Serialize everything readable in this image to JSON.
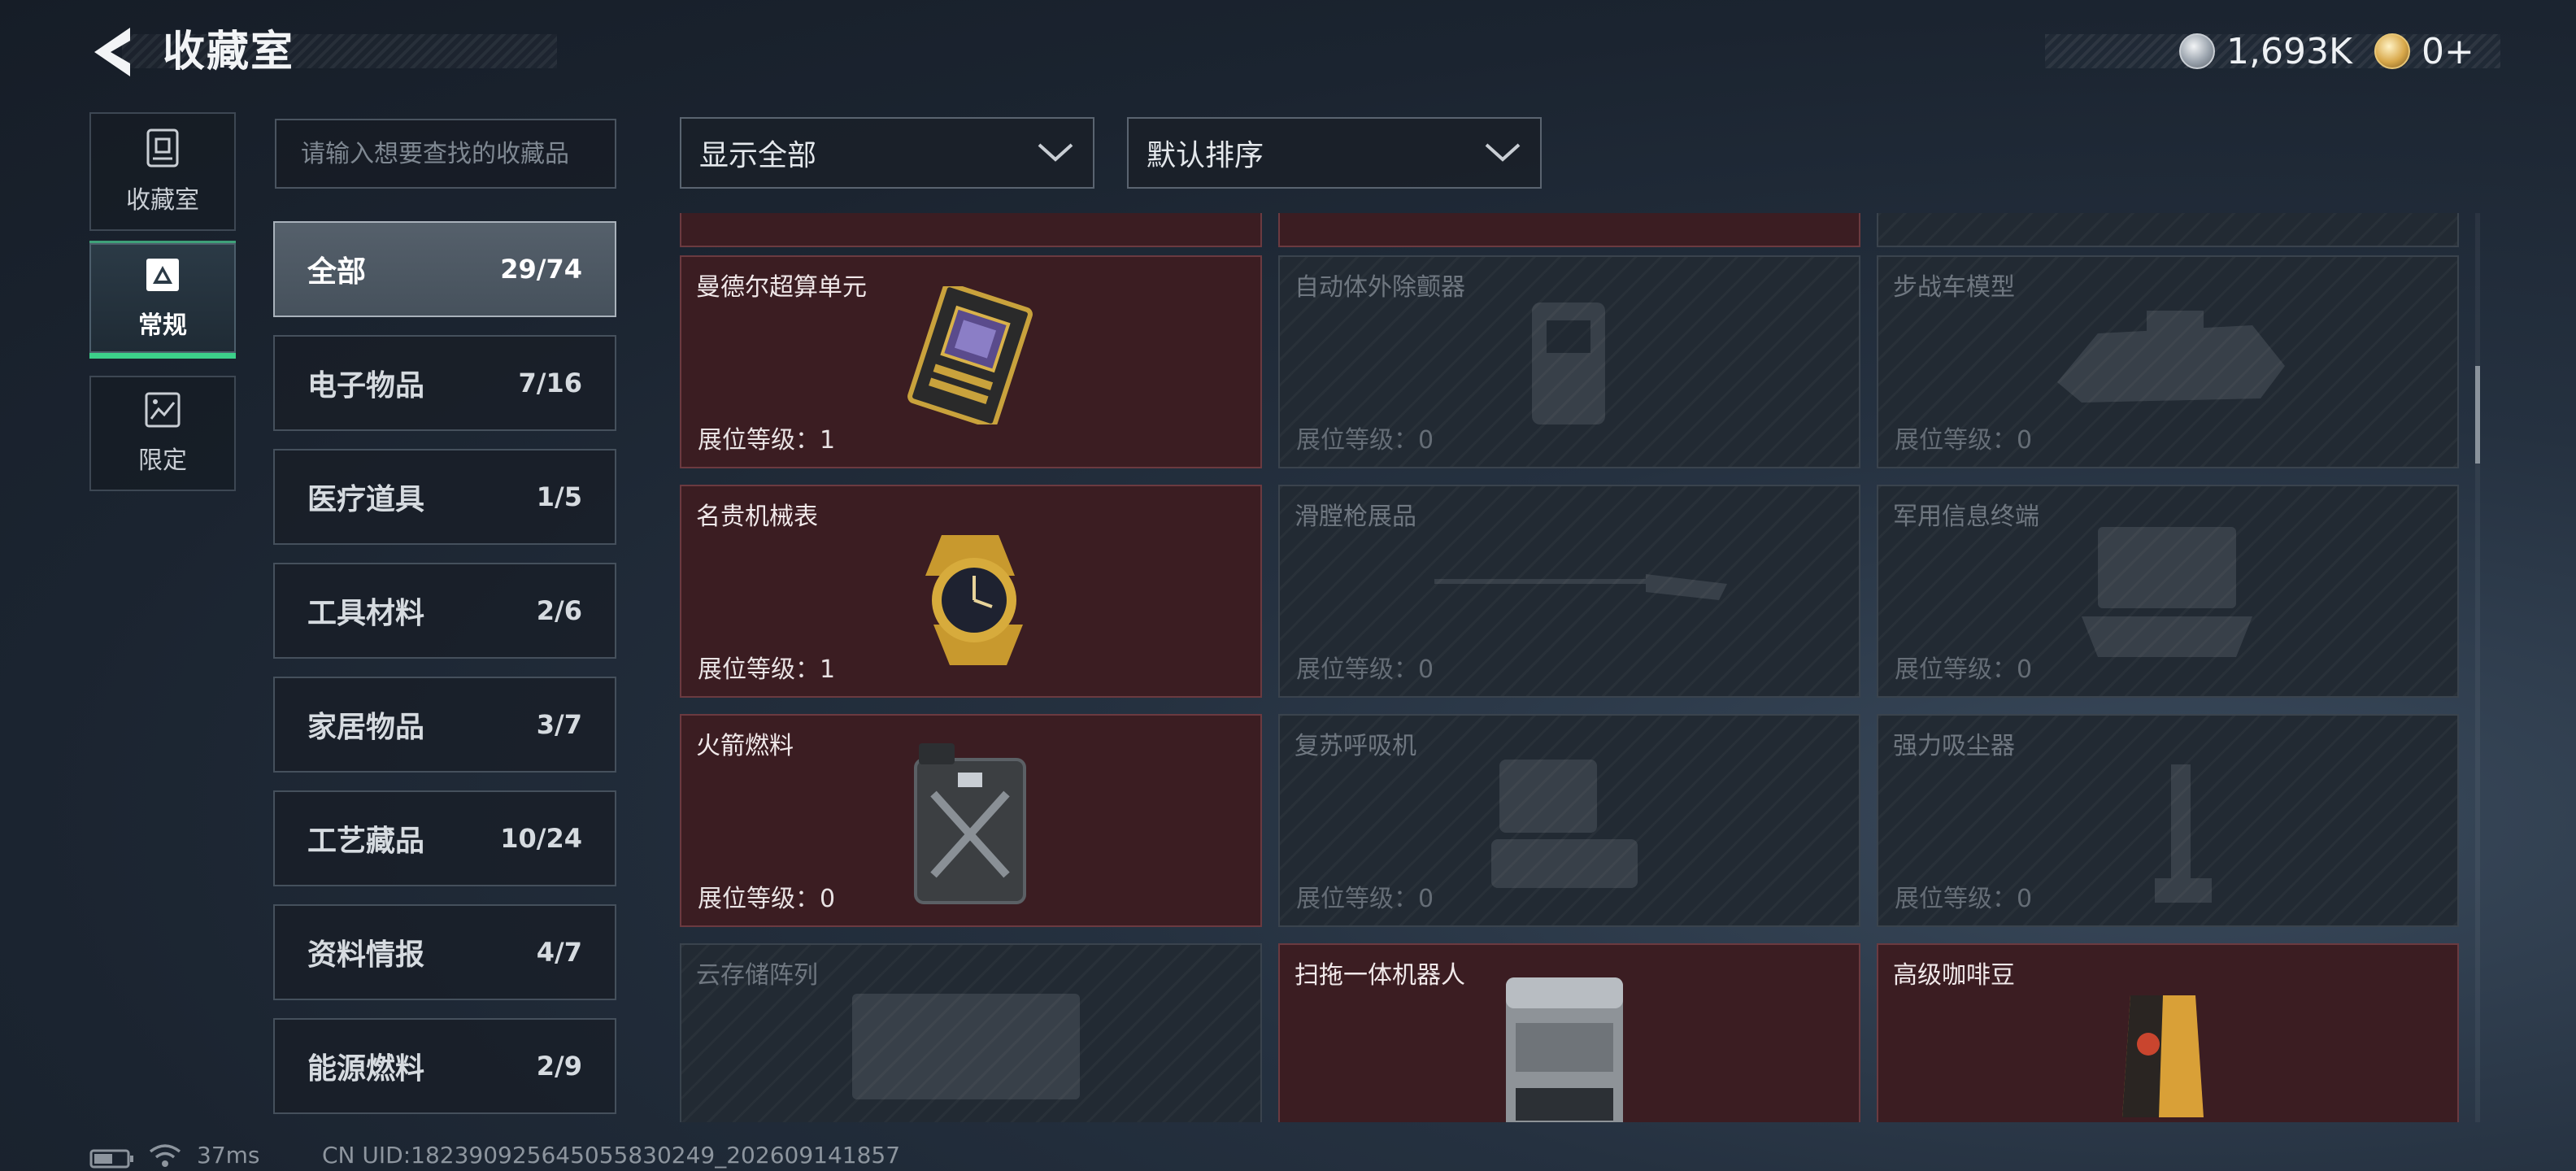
{
  "header": {
    "title": "收藏室",
    "currencies": [
      {
        "icon": "silver-coin-icon",
        "value": "1,693K"
      },
      {
        "icon": "gold-coin-icon",
        "value": "0+"
      }
    ]
  },
  "rail": [
    {
      "label": "收藏室",
      "icon": "collection-room-icon",
      "active": false
    },
    {
      "label": "常规",
      "icon": "regular-icon",
      "active": true
    },
    {
      "label": "限定",
      "icon": "limited-icon",
      "active": false
    }
  ],
  "search": {
    "placeholder": "请输入想要查找的收藏品"
  },
  "filters": {
    "display": "显示全部",
    "sort": "默认排序"
  },
  "categories": [
    {
      "name": "全部",
      "count": "29/74",
      "active": true
    },
    {
      "name": "电子物品",
      "count": "7/16"
    },
    {
      "name": "医疗道具",
      "count": "1/5"
    },
    {
      "name": "工具材料",
      "count": "2/6"
    },
    {
      "name": "家居物品",
      "count": "3/7"
    },
    {
      "name": "工艺藏品",
      "count": "10/24"
    },
    {
      "name": "资料情报",
      "count": "4/7"
    },
    {
      "name": "能源燃料",
      "count": "2/9"
    }
  ],
  "grid": {
    "level_prefix": "展位等级：",
    "items": [
      {
        "name": "曼德尔超算单元",
        "level": "1",
        "owned": true,
        "icon": "supercomputer-unit-icon"
      },
      {
        "name": "自动体外除颤器",
        "level": "0",
        "owned": false,
        "icon": "defibrillator-icon"
      },
      {
        "name": "步战车模型",
        "level": "0",
        "owned": false,
        "icon": "ifv-model-icon"
      },
      {
        "name": "名贵机械表",
        "level": "1",
        "owned": true,
        "icon": "mechanical-watch-icon"
      },
      {
        "name": "滑膛枪展品",
        "level": "0",
        "owned": false,
        "icon": "musket-icon"
      },
      {
        "name": "军用信息终端",
        "level": "0",
        "owned": false,
        "icon": "military-terminal-icon"
      },
      {
        "name": "火箭燃料",
        "level": "0",
        "owned": true,
        "icon": "fuel-can-icon"
      },
      {
        "name": "复苏呼吸机",
        "level": "0",
        "owned": false,
        "icon": "ventilator-icon"
      },
      {
        "name": "强力吸尘器",
        "level": "0",
        "owned": false,
        "icon": "vacuum-cleaner-icon"
      },
      {
        "name": "云存储阵列",
        "level": "",
        "owned": false,
        "icon": "storage-array-icon"
      },
      {
        "name": "扫拖一体机器人",
        "level": "",
        "owned": true,
        "icon": "mop-robot-icon"
      },
      {
        "name": "高级咖啡豆",
        "level": "",
        "owned": true,
        "icon": "coffee-beans-icon"
      }
    ]
  },
  "status_bar": {
    "ping": "37ms",
    "uid": "CN UID:182390925645055830249_202609141857"
  }
}
